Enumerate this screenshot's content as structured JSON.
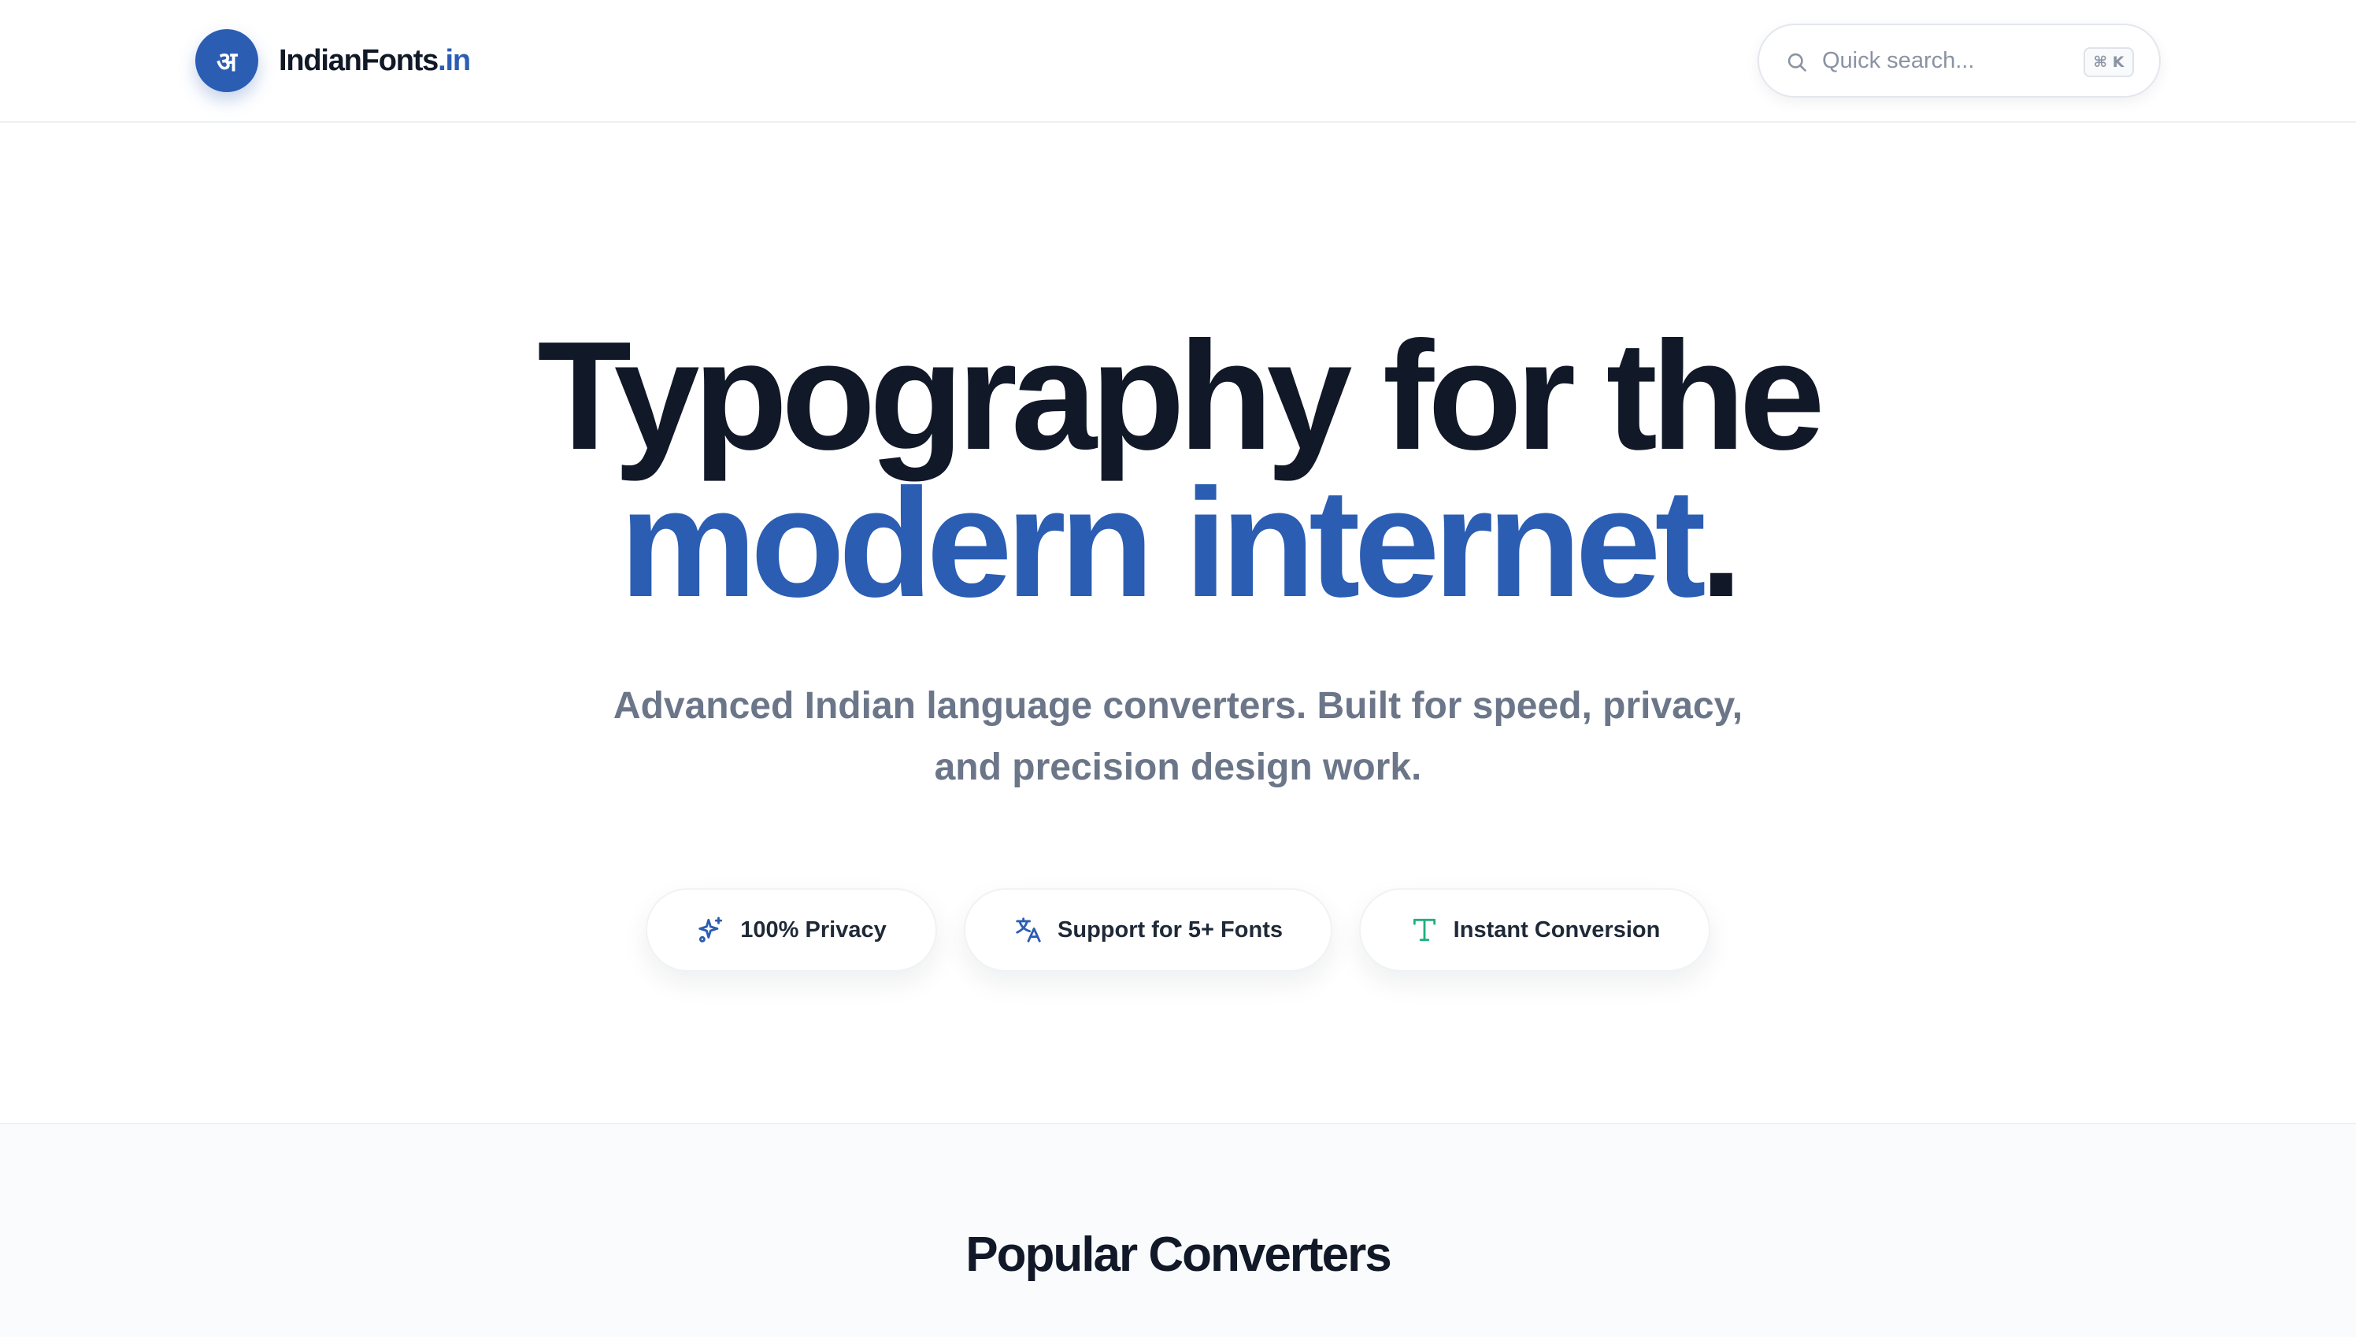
{
  "header": {
    "logo_glyph": "अ",
    "brand_name": "IndianFonts",
    "brand_tld": ".in",
    "search": {
      "placeholder": "Quick search...",
      "shortcut": "⌘ K"
    }
  },
  "hero": {
    "line1": "Typography for the",
    "line2_accent": "modern internet",
    "line2_punct": ".",
    "subtitle_line1": "Advanced Indian language converters. Built for speed, privacy,",
    "subtitle_line2": "and precision design work."
  },
  "features": [
    {
      "label": "100% Privacy",
      "icon": "sparkles-icon"
    },
    {
      "label": "Support for 5+ Fonts",
      "icon": "translate-icon"
    },
    {
      "label": "Instant Conversion",
      "icon": "type-icon"
    }
  ],
  "popular": {
    "title": "Popular Converters"
  },
  "colors": {
    "brand": "#2b5db3",
    "heading": "#111827",
    "muted": "#6b7689",
    "instant_icon": "#22b07d"
  }
}
